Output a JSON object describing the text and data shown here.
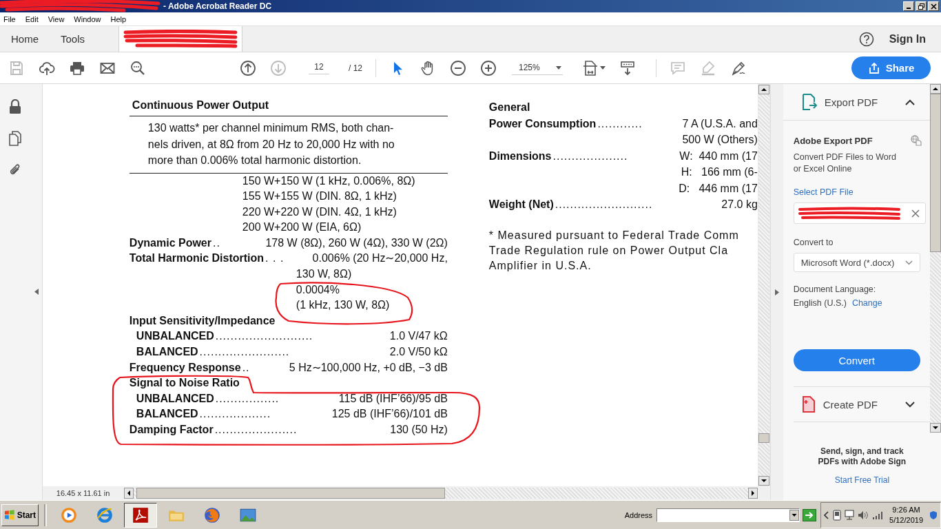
{
  "window": {
    "title": "- Adobe Acrobat Reader DC"
  },
  "menu": [
    "File",
    "Edit",
    "View",
    "Window",
    "Help"
  ],
  "tabs": [
    "Home",
    "Tools"
  ],
  "sign_in": "Sign In",
  "toolbar": {
    "file_tools": [
      {
        "kind": "save",
        "disabled": true
      },
      {
        "kind": "upload",
        "disabled": false
      },
      {
        "kind": "print",
        "disabled": false
      },
      {
        "kind": "mail",
        "disabled": false
      },
      {
        "kind": "find",
        "disabled": false
      }
    ],
    "nav": [
      {
        "kind": "up",
        "disabled": false
      },
      {
        "kind": "down",
        "disabled": true
      }
    ],
    "page": "12",
    "page_total": "/ 12",
    "view_tools": [
      {
        "kind": "select",
        "selected": true
      },
      {
        "kind": "hand",
        "selected": false
      },
      {
        "kind": "zoomout",
        "selected": false
      },
      {
        "kind": "zoomin",
        "selected": false
      }
    ],
    "zoom": "125%",
    "layout_tools": [
      {
        "kind": "fit"
      },
      {
        "kind": "scroll"
      }
    ],
    "annotate_tools": [
      {
        "kind": "comment",
        "disabled": true
      },
      {
        "kind": "highlight",
        "disabled": true
      },
      {
        "kind": "sign",
        "disabled": false
      }
    ],
    "share": "Share"
  },
  "document": {
    "left": [
      {
        "kind": "section",
        "text": "Continuous Power Output"
      },
      {
        "kind": "note",
        "text": "130 watts* per channel minimum RMS, both chan-\nnels driven, at 8Ω  from 20 Hz to 20,000 Hz with no\nmore than 0.006% total harmonic distortion."
      },
      {
        "kind": "value",
        "text": "150 W+150 W (1 kHz, 0.006%, 8Ω)"
      },
      {
        "kind": "value",
        "text": "155 W+155 W (DIN. 8Ω, 1 kHz)"
      },
      {
        "kind": "value",
        "text": "220 W+220 W (DIN. 4Ω, 1 kHz)"
      },
      {
        "kind": "value",
        "text": "200 W+200 W (EIA, 6Ω)"
      },
      {
        "kind": "spec",
        "label": "Dynamic Power",
        "leader": "..",
        "value": "178 W (8Ω), 260 W (4Ω), 330 W (2Ω)"
      },
      {
        "kind": "spec",
        "label": "Total Harmonic Distortion",
        "leader": ". . .",
        "value": "0.006% (20 Hz∼20,000 Hz,"
      },
      {
        "kind": "continued",
        "text": "130 W, 8Ω)"
      },
      {
        "kind": "continued",
        "text": "0.0004%"
      },
      {
        "kind": "continued",
        "text": "(1 kHz, 130 W, 8Ω)"
      },
      {
        "kind": "group",
        "text": "Input Sensitivity/Impedance"
      },
      {
        "kind": "sub",
        "label": "UNBALANCED",
        "leader": "..........................",
        "value": "1.0 V/47 kΩ"
      },
      {
        "kind": "sub",
        "label": "BALANCED",
        "leader": "........................",
        "value": "2.0 V/50 kΩ"
      },
      {
        "kind": "spec",
        "label": "Frequency Response",
        "leader": "..",
        "value": "5 Hz∼100,000 Hz, +0 dB, −3 dB"
      },
      {
        "kind": "group",
        "text": "Signal to Noise Ratio"
      },
      {
        "kind": "sub",
        "label": "UNBALANCED",
        "leader": ".................",
        "value": "115 dB (IHF’66)/95 dB"
      },
      {
        "kind": "sub",
        "label": "BALANCED",
        "leader": "...................",
        "value": "125 dB (IHF’66)/101 dB"
      },
      {
        "kind": "spec",
        "label": "Damping Factor",
        "leader": "......................",
        "value": "130 (50 Hz)"
      }
    ],
    "right": [
      {
        "kind": "group",
        "text": "General"
      },
      {
        "kind": "spec",
        "label": "Power Consumption",
        "leader": "............",
        "value": "7 A (U.S.A. and"
      },
      {
        "kind": "continued",
        "text": "500 W (Others)"
      },
      {
        "kind": "spec",
        "label": "Dimensions",
        "leader": "....................",
        "value": "W:  440 mm (17"
      },
      {
        "kind": "continued",
        "text": "H:   166 mm (6-"
      },
      {
        "kind": "continued",
        "text": "D:   446 mm (17"
      },
      {
        "kind": "spec",
        "label": "Weight (Net)",
        "leader": "..........................",
        "value": "27.0 kg"
      },
      {
        "kind": "footnote",
        "text": "* Measured pursuant to Federal Trade Comm\nTrade Regulation rule on Power Output Cla\nAmplifier in U.S.A."
      }
    ]
  },
  "status_bar": {
    "page_size": "16.45 x 11.61 in"
  },
  "right_pane": {
    "export_title": "Export PDF",
    "expanded": true,
    "heading": "Adobe Export PDF",
    "description": "Convert PDF Files to Word\nor Excel Online",
    "select_link": "Select PDF File",
    "convert_label": "Convert to",
    "convert_format": "Microsoft Word (*.docx)",
    "language_label": "Document Language:",
    "language": "English (U.S.)",
    "change_link": "Change",
    "convert_button": "Convert",
    "create_title": "Create PDF",
    "promo": "Send, sign, and track\nPDFs with Adobe Sign",
    "trial_link": "Start Free Trial"
  },
  "taskbar": {
    "start": "Start",
    "apps": [
      {
        "kind": "media",
        "selected": false
      },
      {
        "kind": "ie",
        "selected": false
      },
      {
        "kind": "acrobat",
        "selected": true
      },
      {
        "kind": "folder",
        "selected": false
      },
      {
        "kind": "firefox",
        "selected": false
      },
      {
        "kind": "photo",
        "selected": false
      }
    ],
    "address_label": "Address",
    "time": "9:26 AM",
    "date": "5/12/2019"
  }
}
